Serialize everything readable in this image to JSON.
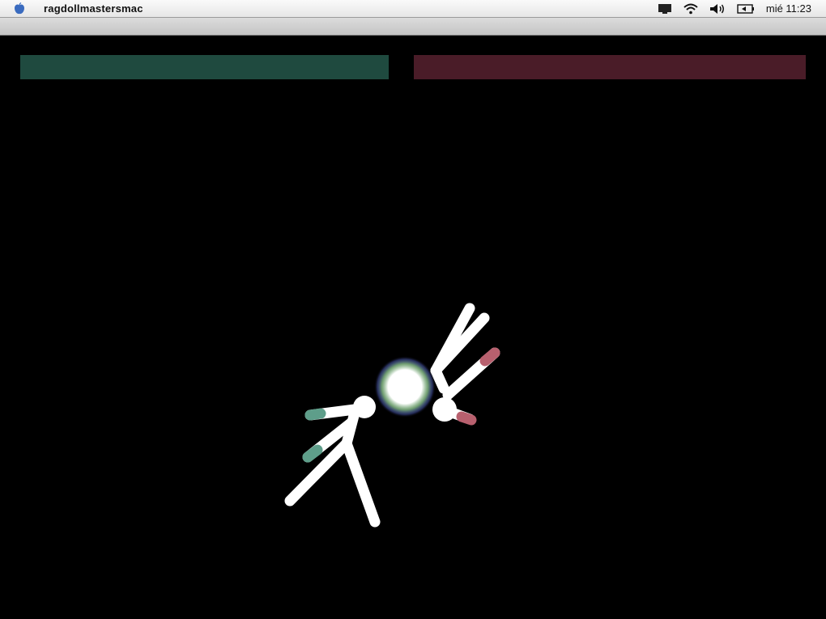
{
  "menubar": {
    "app_name": "ragdollmastersmac",
    "clock": "mié 11:23"
  },
  "icons": {
    "apple": "apple-icon",
    "display": "display-icon",
    "wifi": "wifi-icon",
    "volume": "volume-icon",
    "battery": "battery-icon"
  },
  "players": [
    {
      "color": "#1f4a3f",
      "accent": "#5e9e8a",
      "health": 1.0
    },
    {
      "color": "#4a1c28",
      "accent": "#b8606e",
      "health": 1.0
    }
  ]
}
